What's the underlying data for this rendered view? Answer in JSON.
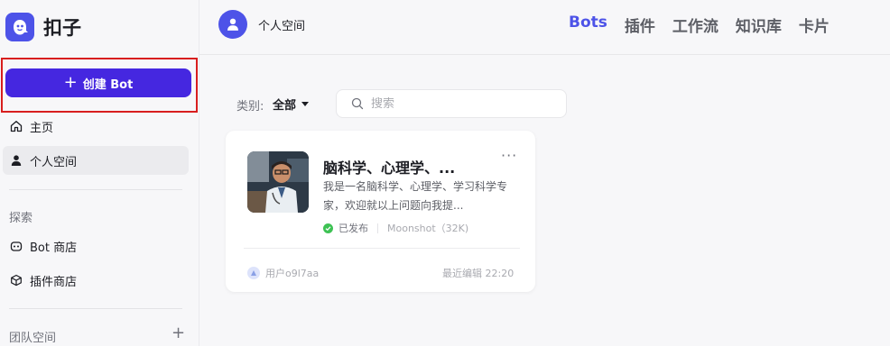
{
  "app": {
    "name": "扣子"
  },
  "sidebar": {
    "create_button": "创建 Bot",
    "items": [
      {
        "label": "主页",
        "icon": "home-icon"
      },
      {
        "label": "个人空间",
        "icon": "person-icon",
        "active": true
      }
    ],
    "explore_label": "探索",
    "explore_items": [
      {
        "label": "Bot 商店",
        "icon": "bot-icon"
      },
      {
        "label": "插件商店",
        "icon": "cube-icon"
      }
    ],
    "team_label": "团队空间",
    "team_add": "+"
  },
  "workspace": {
    "name": "个人空间"
  },
  "tabs": [
    {
      "label": "Bots",
      "active": true
    },
    {
      "label": "插件"
    },
    {
      "label": "工作流"
    },
    {
      "label": "知识库"
    },
    {
      "label": "卡片"
    }
  ],
  "filter": {
    "label": "类别:",
    "value": "全部"
  },
  "search": {
    "placeholder": "搜索",
    "value": ""
  },
  "card": {
    "title": "脑科学、心理学、...",
    "more": "···",
    "description": "我是一名脑科学、心理学、学习科学专家，欢迎就以上问题向我提...",
    "status": "已发布",
    "model": "Moonshot（32K)",
    "author": "用户o9l7aa",
    "edited": "最近编辑 22:20"
  },
  "colors": {
    "accent": "#4d53e8",
    "create_button": "#4527e0",
    "highlight_border": "#d81e1e",
    "published": "#3ec254"
  }
}
